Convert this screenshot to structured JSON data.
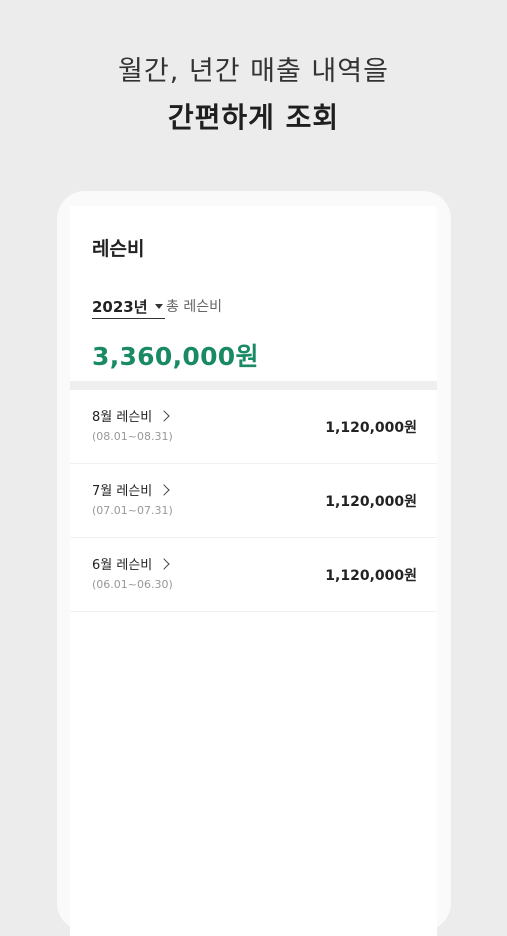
{
  "headline": {
    "line1": "월간, 년간 매출 내역을",
    "line2": "간편하게 조회"
  },
  "card": {
    "title": "레슨비",
    "year": "2023년",
    "total_label": "총 레슨비",
    "total_amount": "3,360,000원"
  },
  "months": [
    {
      "label": "8월 레슨비",
      "range": "(08.01~08.31)",
      "amount": "1,120,000원"
    },
    {
      "label": "7월 레슨비",
      "range": "(07.01~07.31)",
      "amount": "1,120,000원"
    },
    {
      "label": "6월 레슨비",
      "range": "(06.01~06.30)",
      "amount": "1,120,000원"
    }
  ],
  "colors": {
    "accent": "#1a8a64",
    "background": "#ececec"
  },
  "icons": {
    "year_dropdown": "caret-down-icon",
    "row_arrow": "chevron-right-icon"
  }
}
